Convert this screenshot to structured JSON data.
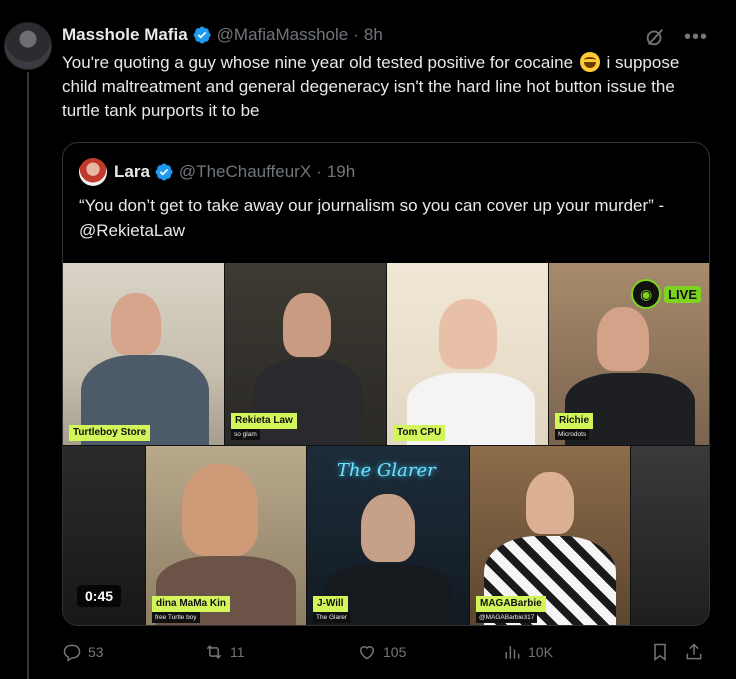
{
  "tweet": {
    "display_name": "Masshole Mafia",
    "handle": "@MafiaMasshole",
    "separator": "·",
    "time": "8h",
    "text_before_emoji": "You're quoting a guy whose nine year old tested positive for cocaine",
    "emoji": "grinning-squinting-face",
    "text_after_emoji": " i suppose child maltreatment and general degeneracy isn't the hard line hot button issue the turtle tank purports it to be"
  },
  "quote": {
    "display_name": "Lara",
    "handle": "@TheChauffeurX",
    "separator": "·",
    "time": "19h",
    "text": "“You don’t get to take away our journalism so you can cover up your murder” - @RekietaLaw",
    "video": {
      "duration": "0:45",
      "live_badge": "LIVE",
      "participants": [
        {
          "name": "Turtleboy Store",
          "sub": ""
        },
        {
          "name": "Rekieta Law",
          "sub": "so glam"
        },
        {
          "name": "Tom CPU",
          "sub": ""
        },
        {
          "name": "Richie",
          "sub": "Microdots"
        },
        {
          "name": "dina MaMa Kin",
          "sub": "free Turtle boy"
        },
        {
          "name": "J-Will",
          "sub": "The Glarer"
        },
        {
          "name": "MAGABarbie",
          "sub": "@MAGABarbie317"
        }
      ],
      "neon_sign": "The Glarer"
    }
  },
  "actions": {
    "replies": "53",
    "reposts": "11",
    "likes": "105",
    "views": "10K"
  },
  "colors": {
    "background": "#000000",
    "text_primary": "#e7e9ea",
    "text_secondary": "#71767b",
    "verified": "#1d9bf0",
    "border": "#2f3336",
    "name_tag": "#d2f55a"
  }
}
